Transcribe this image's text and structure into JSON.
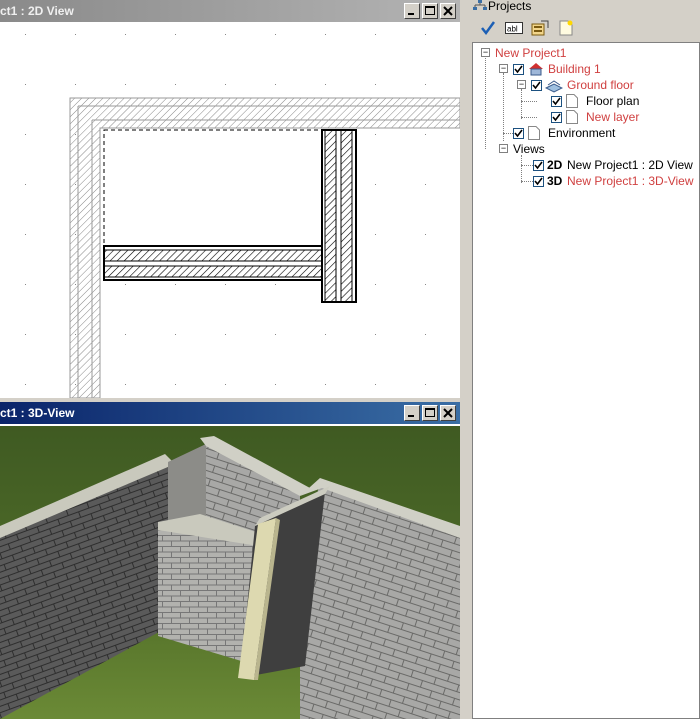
{
  "view2d": {
    "title": "ct1 : 2D View"
  },
  "view3d": {
    "title": "ct1 : 3D-View"
  },
  "projects": {
    "title": "Projects",
    "toolbar": [
      "check-icon",
      "rename-icon",
      "properties-icon",
      "new-icon"
    ],
    "tree": {
      "project": "New Project1",
      "building": "Building 1",
      "floor": "Ground floor",
      "floor_plan": "Floor plan",
      "new_layer": "New layer",
      "environment": "Environment",
      "views": "Views",
      "view_2d_tag": "2D",
      "view_2d": "New Project1 : 2D View",
      "view_3d_tag": "3D",
      "view_3d": "New Project1 : 3D-View"
    }
  },
  "colors": {
    "highlight_red": "#d04040",
    "active_title": "#0a246a",
    "grass": "#5b7a2e",
    "brick": "#8a8a88"
  }
}
